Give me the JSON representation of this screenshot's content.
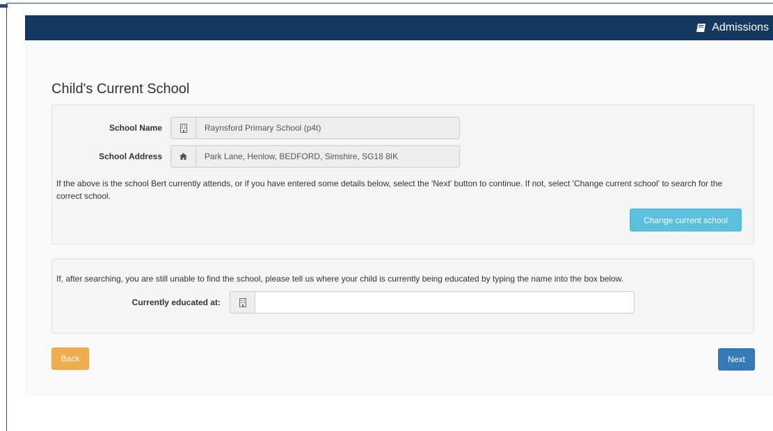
{
  "header": {
    "brand_label": "Admissions",
    "brand_icon": "book-icon",
    "background_color": "#133a5e"
  },
  "page": {
    "title": "Child's Current School"
  },
  "current_school": {
    "name_label": "School Name",
    "name_value": "Raynsford Primary School (p4t)",
    "name_icon": "building-icon",
    "address_label": "School Address",
    "address_value": "Park Lane, Henlow, BEDFORD, Simshire, SG18 8IK",
    "address_icon": "home-icon",
    "help_text": "If the above is the school Bert currently attends, or if you have entered some details below, select the 'Next' button to continue. If not, select 'Change current school' to search for the correct school.",
    "change_button_label": "Change current school"
  },
  "educated_at": {
    "help_text": "If, after searching, you are still unable to find the school, please tell us where your child is currently being educated by typing the name into the box below.",
    "label": "Currently educated at:",
    "icon": "building-icon",
    "value": "",
    "placeholder": ""
  },
  "nav": {
    "back_label": "Back",
    "next_label": "Next"
  },
  "colors": {
    "info": "#5bc0de",
    "warning": "#f0ad4e",
    "primary": "#337ab7"
  }
}
